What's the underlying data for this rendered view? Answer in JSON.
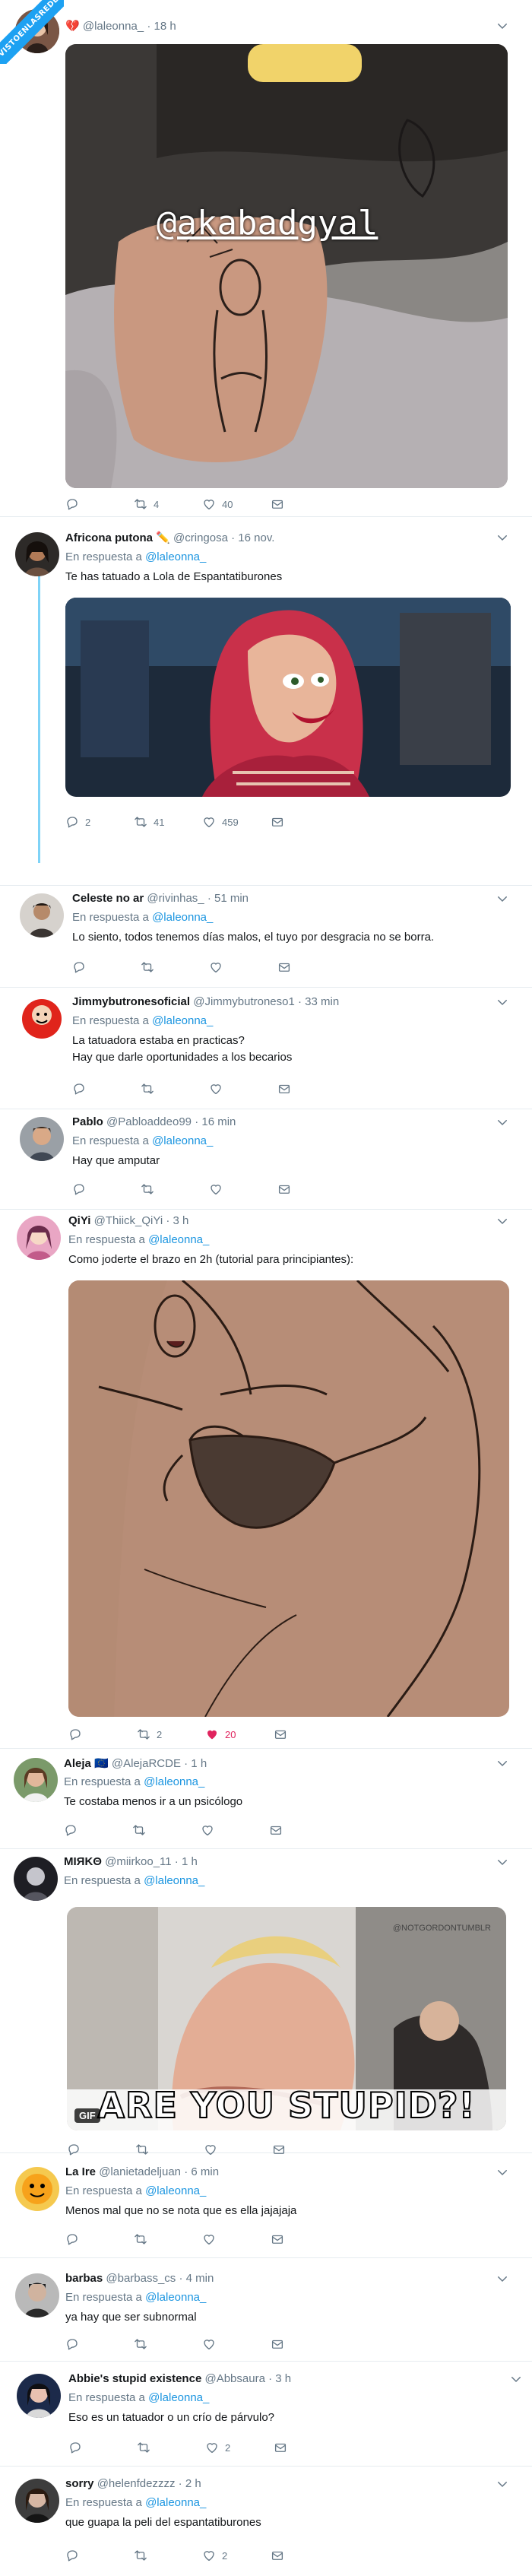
{
  "badge": {
    "text": "VISTOENLASREDES"
  },
  "tweets": [
    {
      "name": "",
      "handle": "@laleonna_",
      "time": "· 18 h",
      "reply_label": "",
      "reply_to": "",
      "text": [],
      "media_overlay": "@akabadgyal",
      "stats": {
        "reply": "",
        "retweet": "4",
        "like": "40"
      }
    },
    {
      "name": "Africona putona ✏️",
      "handle": "@cringosa",
      "time": "· 16 nov.",
      "reply_label": "En respuesta a",
      "reply_to": "@laleonna_",
      "text": [
        "Te has tatuado a Lola de Espantatiburones"
      ],
      "stats": {
        "reply": "2",
        "retweet": "41",
        "like": "459"
      }
    },
    {
      "name": "Celeste no ar",
      "handle": "@rivinhas_",
      "time": "· 51 min",
      "reply_label": "En respuesta a",
      "reply_to": "@laleonna_",
      "text": [
        "Lo siento, todos tenemos días malos, el tuyo por desgracia no se borra."
      ],
      "stats": {
        "reply": "",
        "retweet": "",
        "like": ""
      }
    },
    {
      "name": "Jimmybutronesoficial",
      "handle": "@Jimmybutroneso1",
      "time": "· 33 min",
      "reply_label": "En respuesta a",
      "reply_to": "@laleonna_",
      "text": [
        "La tatuadora estaba en practicas?",
        "Hay que darle oportunidades a los becarios"
      ],
      "stats": {
        "reply": "",
        "retweet": "",
        "like": ""
      }
    },
    {
      "name": "Pablo",
      "handle": "@Pabloaddeo99",
      "time": "· 16 min",
      "reply_label": "En respuesta a",
      "reply_to": "@laleonna_",
      "text": [
        "Hay que amputar"
      ],
      "stats": {
        "reply": "",
        "retweet": "",
        "like": ""
      }
    },
    {
      "name": "QiYi",
      "handle": "@Thiick_QiYi",
      "time": "· 3 h",
      "reply_label": "En respuesta a",
      "reply_to": "@laleonna_",
      "text": [
        "Como joderte el brazo en 2h (tutorial para principiantes):"
      ],
      "stats": {
        "reply": "",
        "retweet": "2",
        "like": "20"
      }
    },
    {
      "name": "Aleja 🇪🇺",
      "handle": "@AlejaRCDE",
      "time": "· 1 h",
      "reply_label": "En respuesta a",
      "reply_to": "@laleonna_",
      "text": [
        "Te costaba menos ir a un psicólogo"
      ],
      "stats": {
        "reply": "",
        "retweet": "",
        "like": ""
      }
    },
    {
      "name": "MIЯKΘ",
      "handle": "@miirkoo_11",
      "time": "· 1 h",
      "reply_label": "En respuesta a",
      "reply_to": "@laleonna_",
      "text": [],
      "media_caption": "ARE YOU STUPID?!",
      "media_gif": "GIF",
      "media_watermark": "@NOTGORDONTUMBLR",
      "stats": {
        "reply": "",
        "retweet": "",
        "like": ""
      }
    },
    {
      "name": "La Ire",
      "handle": "@lanietadeljuan",
      "time": "· 6 min",
      "reply_label": "En respuesta a",
      "reply_to": "@laleonna_",
      "text": [
        "Menos mal que no se nota que es ella jajajaja"
      ],
      "stats": {
        "reply": "",
        "retweet": "",
        "like": ""
      }
    },
    {
      "name": "barbas",
      "handle": "@barbass_cs",
      "time": "· 4 min",
      "reply_label": "En respuesta a",
      "reply_to": "@laleonna_",
      "text": [
        "ya hay que ser subnormal"
      ],
      "stats": {
        "reply": "",
        "retweet": "",
        "like": ""
      }
    },
    {
      "name": "Abbie's stupid existence",
      "handle": "@Abbsaura",
      "time": "· 3 h",
      "reply_label": "En respuesta a",
      "reply_to": "@laleonna_",
      "text": [
        "Eso es un tatuador o un crío de párvulo?"
      ],
      "stats": {
        "reply": "",
        "retweet": "",
        "like": "2"
      }
    },
    {
      "name": "sorry",
      "handle": "@helenfdezzzz",
      "time": "· 2 h",
      "reply_label": "En respuesta a",
      "reply_to": "@laleonna_",
      "text": [
        "que guapa la peli del espantatiburones"
      ],
      "stats": {
        "reply": "",
        "retweet": "",
        "like": "2"
      }
    }
  ]
}
